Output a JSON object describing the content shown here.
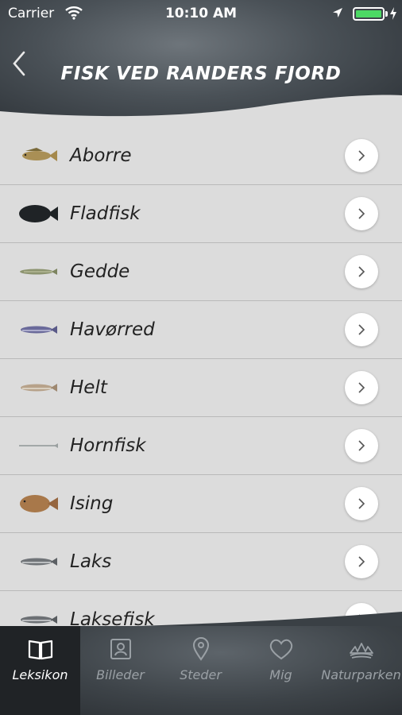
{
  "status_bar": {
    "carrier": "Carrier",
    "time": "10:10 AM",
    "battery_level": 1.0
  },
  "header": {
    "title": "FISK VED RANDERS FJORD",
    "back_icon": "chevron-left-icon"
  },
  "fish_list": [
    {
      "label": "Aborre",
      "icon": "perch-icon"
    },
    {
      "label": "Fladfisk",
      "icon": "flatfish-silhouette-icon"
    },
    {
      "label": "Gedde",
      "icon": "pike-icon"
    },
    {
      "label": "Havørred",
      "icon": "sea-trout-icon"
    },
    {
      "label": "Helt",
      "icon": "whitefish-icon"
    },
    {
      "label": "Hornfisk",
      "icon": "garfish-icon"
    },
    {
      "label": "Ising",
      "icon": "dab-icon"
    },
    {
      "label": "Laks",
      "icon": "salmon-icon"
    },
    {
      "label": "Laksefisk",
      "icon": "salmonid-icon"
    }
  ],
  "tabs": [
    {
      "label": "Leksikon",
      "icon": "book-icon",
      "active": true
    },
    {
      "label": "Billeder",
      "icon": "photo-portrait-icon",
      "active": false
    },
    {
      "label": "Steder",
      "icon": "location-pin-icon",
      "active": false
    },
    {
      "label": "Mig",
      "icon": "heart-icon",
      "active": false
    },
    {
      "label": "Naturparken",
      "icon": "naturpark-logo-icon",
      "active": false
    }
  ],
  "colors": {
    "header_bg": "#4a5157",
    "list_bg": "#dcdcdc",
    "divider": "#b9b9b9",
    "active_tab": "#202326",
    "battery": "#4cd964"
  }
}
